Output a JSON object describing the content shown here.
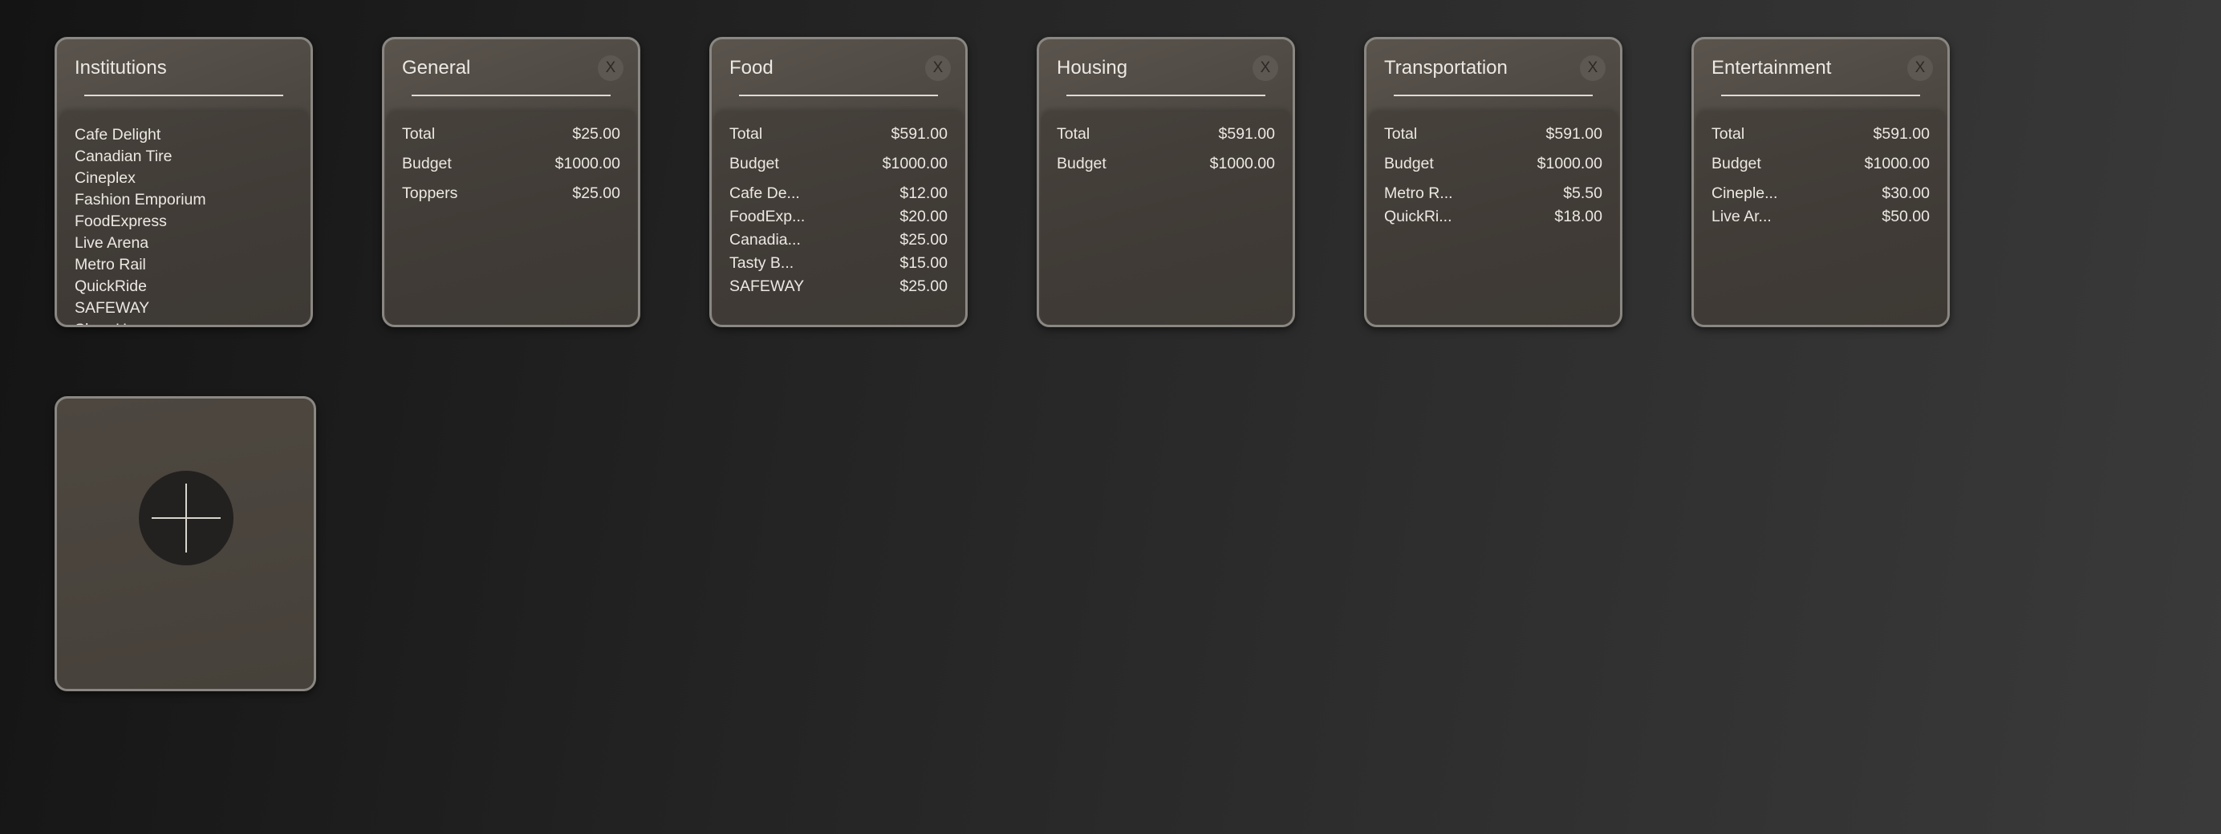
{
  "institutions": {
    "title": "Institutions",
    "items": [
      "Cafe Delight",
      "Canadian Tire",
      "Cineplex",
      "Fashion Emporium",
      "FoodExpress",
      "Live Arena",
      "Metro Rail",
      "QuickRide",
      "SAFEWAY",
      "Shoe Haven"
    ]
  },
  "categories": [
    {
      "title": "General",
      "close_label": "X",
      "total_label": "Total",
      "total": "$25.00",
      "budget_label": "Budget",
      "budget": "$1000.00",
      "entries": [
        {
          "name": "Toppers",
          "amount": "$25.00"
        }
      ]
    },
    {
      "title": "Food",
      "close_label": "X",
      "total_label": "Total",
      "total": "$591.00",
      "budget_label": "Budget",
      "budget": "$1000.00",
      "entries": [
        {
          "name": "Cafe De...",
          "amount": "$12.00"
        },
        {
          "name": "FoodExp...",
          "amount": "$20.00"
        },
        {
          "name": "Canadia...",
          "amount": "$25.00"
        },
        {
          "name": "Tasty B...",
          "amount": "$15.00"
        },
        {
          "name": "SAFEWAY",
          "amount": "$25.00"
        }
      ]
    },
    {
      "title": "Housing",
      "close_label": "X",
      "total_label": "Total",
      "total": "$591.00",
      "budget_label": "Budget",
      "budget": "$1000.00",
      "entries": []
    },
    {
      "title": "Transportation",
      "close_label": "X",
      "total_label": "Total",
      "total": "$591.00",
      "budget_label": "Budget",
      "budget": "$1000.00",
      "entries": [
        {
          "name": "Metro R...",
          "amount": "$5.50"
        },
        {
          "name": "QuickRi...",
          "amount": "$18.00"
        }
      ]
    },
    {
      "title": "Entertainment",
      "close_label": "X",
      "total_label": "Total",
      "total": "$591.00",
      "budget_label": "Budget",
      "budget": "$1000.00",
      "entries": [
        {
          "name": "Cineple...",
          "amount": "$30.00"
        },
        {
          "name": "Live Ar...",
          "amount": "$50.00"
        }
      ]
    }
  ],
  "add_card": {
    "icon": "plus-icon"
  }
}
